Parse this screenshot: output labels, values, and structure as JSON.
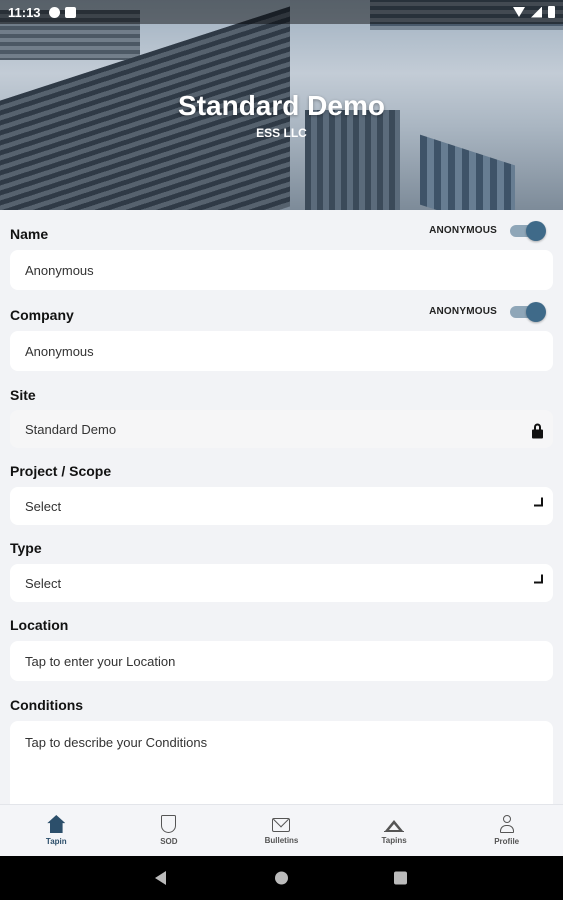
{
  "status_bar": {
    "time": "11:13"
  },
  "header": {
    "title": "Standard Demo",
    "subtitle": "ESS LLC"
  },
  "form": {
    "name": {
      "label": "Name",
      "anonymous_label": "ANONYMOUS",
      "anonymous_on": true,
      "value": "Anonymous"
    },
    "company": {
      "label": "Company",
      "anonymous_label": "ANONYMOUS",
      "anonymous_on": true,
      "value": "Anonymous"
    },
    "site": {
      "label": "Site",
      "value": "Standard Demo",
      "icon": "lock-icon"
    },
    "project_scope": {
      "label": "Project / Scope",
      "value": "Select",
      "icon": "chevron-down-icon"
    },
    "type": {
      "label": "Type",
      "value": "Select",
      "icon": "chevron-down-icon"
    },
    "location": {
      "label": "Location",
      "placeholder": "Tap to enter your Location"
    },
    "conditions": {
      "label": "Conditions",
      "placeholder": "Tap to describe your Conditions"
    }
  },
  "bottom_nav": [
    {
      "label": "Tapin",
      "icon": "home-icon",
      "active": true
    },
    {
      "label": "SOD",
      "icon": "shield-icon",
      "active": false
    },
    {
      "label": "Bulletins",
      "icon": "mail-icon",
      "active": false
    },
    {
      "label": "Tapins",
      "icon": "mountain-icon",
      "active": false
    },
    {
      "label": "Profile",
      "icon": "person-icon",
      "active": false
    }
  ],
  "colors": {
    "accent": "#2c4f6b",
    "toggle_knob": "#3f6a89",
    "toggle_track": "#8fa6b8",
    "background": "#f2f3f6"
  }
}
